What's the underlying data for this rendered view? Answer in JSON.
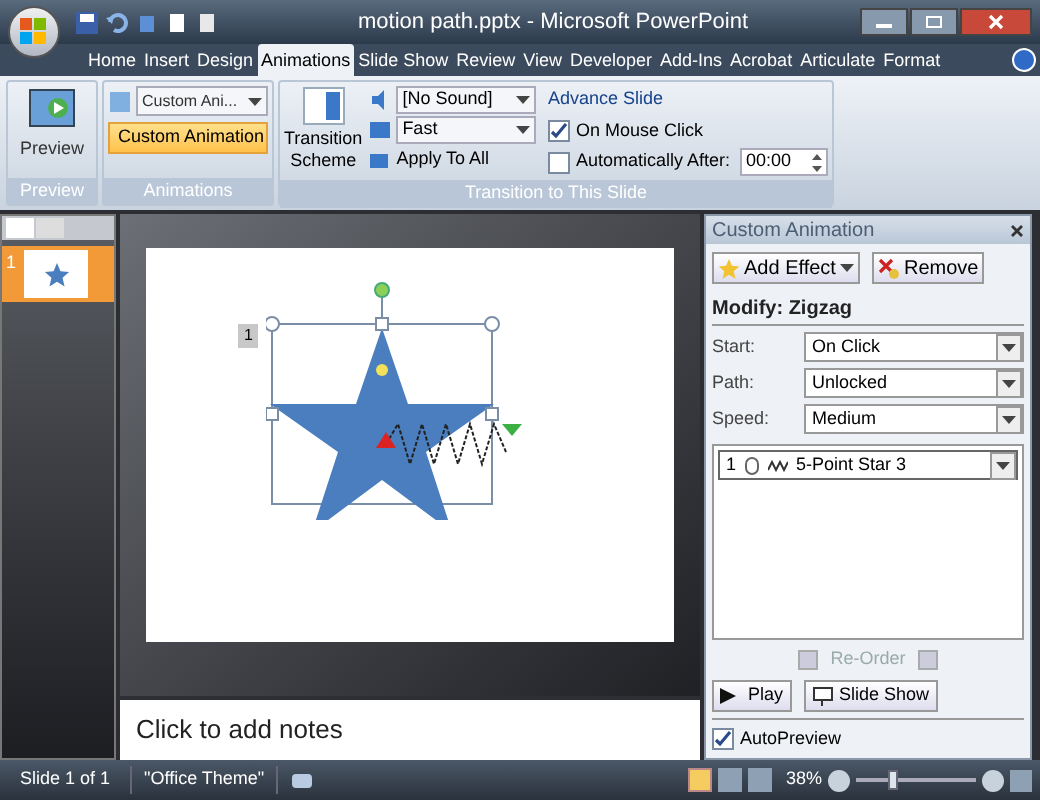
{
  "window": {
    "title": "motion path.pptx - Microsoft PowerPoint"
  },
  "tabs": [
    {
      "label": "Home",
      "selected": false
    },
    {
      "label": "Insert",
      "selected": false
    },
    {
      "label": "Design",
      "selected": false
    },
    {
      "label": "Animations",
      "selected": true
    },
    {
      "label": "Slide Show",
      "selected": false
    },
    {
      "label": "Review",
      "selected": false
    },
    {
      "label": "View",
      "selected": false
    },
    {
      "label": "Developer",
      "selected": false
    },
    {
      "label": "Add-Ins",
      "selected": false
    },
    {
      "label": "Acrobat",
      "selected": false
    },
    {
      "label": "Articulate",
      "selected": false
    },
    {
      "label": "Format",
      "selected": false
    }
  ],
  "ribbon": {
    "preview_group": {
      "button": "Preview",
      "label": "Preview"
    },
    "animations_group": {
      "dropdown": "Custom Ani...",
      "button": "Custom Animation",
      "button_selected": true,
      "label": "Animations"
    },
    "transition_group": {
      "scheme": "Transition Scheme",
      "sound": "[No Sound]",
      "speed": "Fast",
      "apply": "Apply To All",
      "advance_title": "Advance Slide",
      "options": [
        {
          "label": "On Mouse Click",
          "checked": true
        },
        {
          "label": "Automatically After:",
          "checked": false
        }
      ],
      "time": "00:00",
      "label": "Transition to This Slide"
    }
  },
  "slides_panel": {
    "thumbnails": [
      {
        "number": "1",
        "selected": true
      }
    ]
  },
  "slide": {
    "animation_tag": "1"
  },
  "notes": {
    "placeholder": "Click to add notes"
  },
  "task_pane": {
    "title": "Custom Animation",
    "add_effect": "Add Effect",
    "remove": "Remove",
    "modify": "Modify: Zigzag",
    "fields": [
      {
        "label": "Start:",
        "value": "On Click"
      },
      {
        "label": "Path:",
        "value": "Unlocked"
      },
      {
        "label": "Speed:",
        "value": "Medium"
      }
    ],
    "items": [
      {
        "number": "1",
        "label": "5-Point Star 3",
        "selected": true
      }
    ],
    "reorder": "Re-Order",
    "play": "Play",
    "slide_show": "Slide Show",
    "autopreview": {
      "label": "AutoPreview",
      "checked": true
    }
  },
  "status_bar": {
    "slide": "Slide 1 of 1",
    "theme": "\"Office Theme\"",
    "zoom": "38%",
    "zoom_slider": {
      "level": 0.3
    }
  }
}
